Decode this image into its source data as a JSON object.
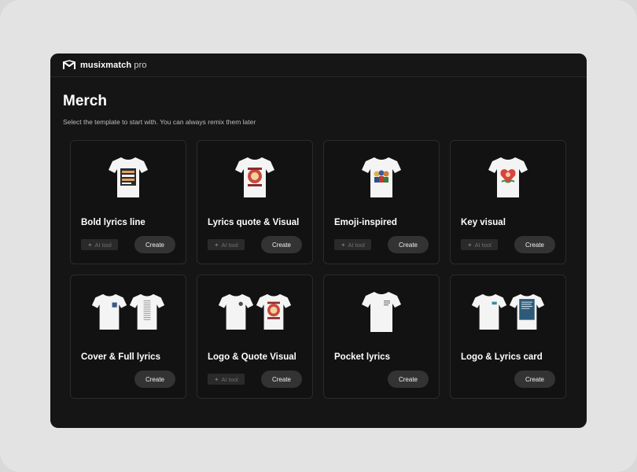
{
  "app": {
    "brand": "musixmatch",
    "brand_suffix": "pro"
  },
  "page": {
    "title": "Merch",
    "subtitle": "Select the template to start with. You can always remix them later"
  },
  "cards": [
    {
      "title": "Bold lyrics line",
      "ai_tag": "AI tool",
      "button": "Create"
    },
    {
      "title": "Lyrics quote & Visual",
      "ai_tag": "AI tool",
      "button": "Create"
    },
    {
      "title": "Emoji-inspired",
      "ai_tag": "AI tool",
      "button": "Create"
    },
    {
      "title": "Key visual",
      "ai_tag": "AI tool",
      "button": "Create"
    },
    {
      "title": "Cover & Full lyrics",
      "button": "Create"
    },
    {
      "title": "Logo & Quote Visual",
      "ai_tag": "AI tool",
      "button": "Create"
    },
    {
      "title": "Pocket lyrics",
      "button": "Create"
    },
    {
      "title": "Logo & Lyrics card",
      "button": "Create"
    }
  ],
  "colors": {
    "background": "#151515",
    "card_border": "#2b2b2b",
    "button": "#333333"
  }
}
